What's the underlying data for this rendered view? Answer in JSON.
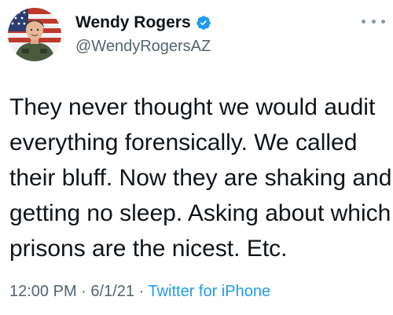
{
  "author": {
    "display_name": "Wendy Rogers",
    "handle": "@WendyRogersAZ",
    "verified_icon": "verified-badge-icon",
    "avatar_icon": "profile-photo"
  },
  "more_menu_icon": "more-options-icon",
  "tweet": {
    "lines": [
      "They never thought we would audit",
      "everything forensically. We called",
      "their bluff. Now they are shaking and",
      "getting no sleep. Asking about which",
      "prisons are the nicest. Etc."
    ]
  },
  "meta": {
    "time": "12:00 PM",
    "separator": "·",
    "date": "6/1/21",
    "source": "Twitter for iPhone"
  },
  "colors": {
    "text": "#0f1419",
    "secondary": "#536471",
    "link": "#1d9bf0",
    "verified": "#1d9bf0"
  }
}
